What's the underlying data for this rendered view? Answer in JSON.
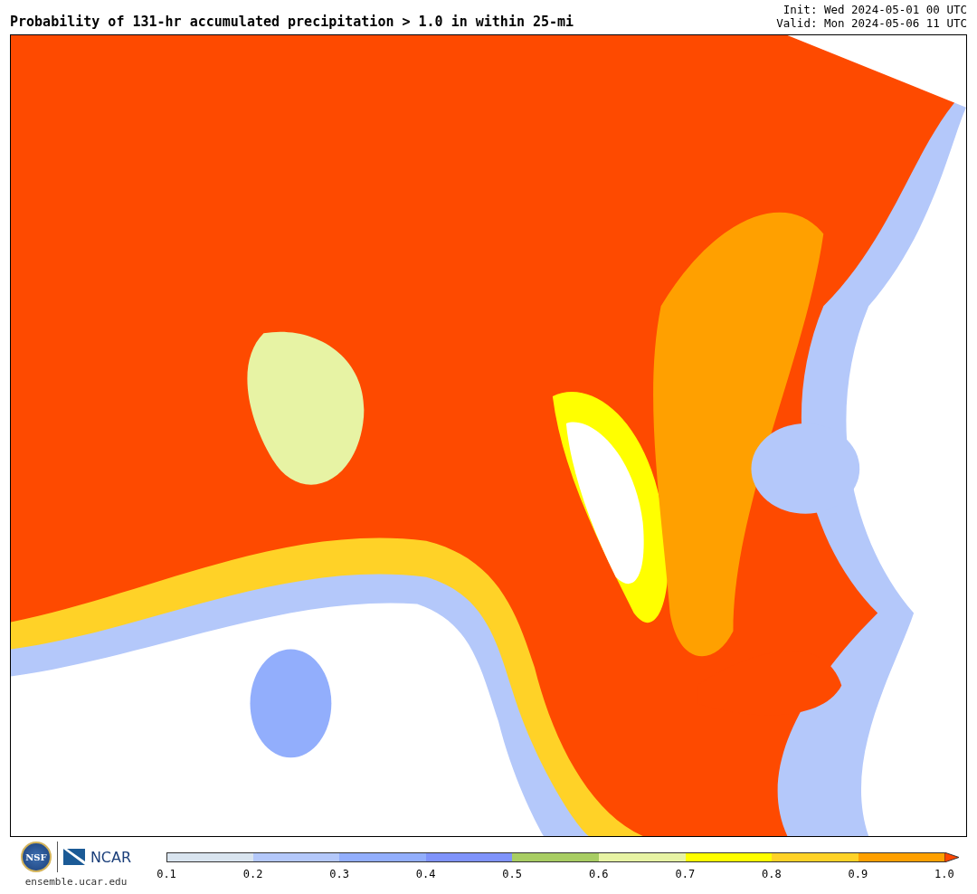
{
  "title": "Probability of 131-hr accumulated precipitation > 1.0 in within 25-mi",
  "init": "Init: Wed 2024-05-01 00 UTC",
  "valid": "Valid: Mon 2024-05-06 11 UTC",
  "logos": {
    "nsf": "NSF",
    "ncar": "NCAR",
    "url": "ensemble.ucar.edu"
  },
  "colorbar": {
    "segments": [
      {
        "color": "#d9e4ef"
      },
      {
        "color": "#b4c8fa"
      },
      {
        "color": "#92aefc"
      },
      {
        "color": "#7f93fb"
      },
      {
        "color": "#a8cd63"
      },
      {
        "color": "#e7f3a4"
      },
      {
        "color": "#ffff00"
      },
      {
        "color": "#ffd227"
      },
      {
        "color": "#ffa000"
      }
    ],
    "extend": {
      "color": "#ff4500"
    },
    "ticks": [
      "0.1",
      "0.2",
      "0.3",
      "0.4",
      "0.5",
      "0.6",
      "0.7",
      "0.8",
      "0.9",
      "1.0"
    ]
  }
}
